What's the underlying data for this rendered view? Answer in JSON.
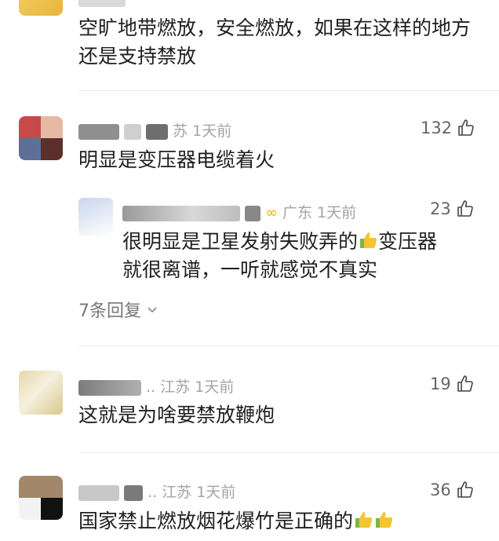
{
  "comments": [
    {
      "text": "空旷地带燃放，安全燃放，如果在这样的地方还是支持禁放"
    },
    {
      "location_time": "苏 1天前",
      "likes": "132",
      "text": "明显是变压器电缆着火",
      "reply": {
        "username_partial": "熬",
        "location_time": "广东 1天前",
        "likes": "23",
        "text_line1": "很明显是卫星发射失败弄的",
        "text_line1b": "变压器",
        "text_line2": "就很离谱，一听就感觉不真实"
      },
      "more_replies": "7条回复"
    },
    {
      "location_time": "江苏 1天前",
      "likes": "19",
      "text": "这就是为啥要禁放鞭炮"
    },
    {
      "location_time": "江苏 1天前",
      "likes": "36",
      "text": "国家禁止燃放烟花爆竹是正确的"
    }
  ],
  "ellipsis": "..",
  "icons": {
    "like": "thumbs-up-icon",
    "chevron": "chevron-down-icon",
    "emoji": "thumbs-up-emoji-icon"
  }
}
